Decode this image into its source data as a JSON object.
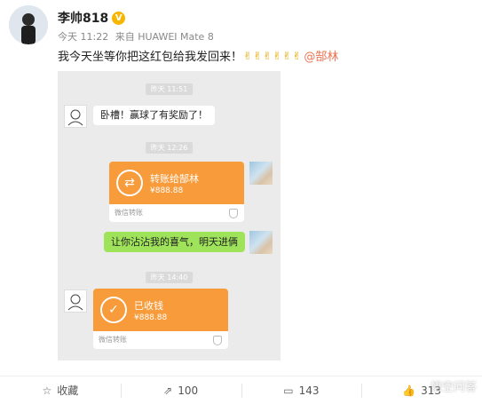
{
  "post": {
    "username": "李帅818",
    "verified_badge": "V",
    "time": "今天 11:22",
    "source": "来自 HUAWEI Mate 8",
    "text": "我今天坐等你把这红包给我发回来！",
    "emojis": [
      "✌",
      "✌",
      "✌",
      "✌",
      "✌",
      "✌"
    ],
    "mention": "@郜林"
  },
  "chat": {
    "timestamps": [
      "昨天 11:51",
      "昨天 12:26",
      "昨天 14:40"
    ],
    "message1": "卧槽！赢球了有奖励了！",
    "transfer1": {
      "title": "转账给郜林",
      "amount": "¥888.88",
      "footer": "微信转账"
    },
    "message2": "让你沾沾我的喜气，明天进俩",
    "transfer2": {
      "title": "已收钱",
      "amount": "¥888.88",
      "footer": "微信转账"
    }
  },
  "footer": {
    "favorite_label": "收藏",
    "repost_count": "100",
    "comment_count": "143",
    "like_count": "313"
  },
  "watermark": "悟空问答",
  "colors": {
    "accent": "#eb7350",
    "transfer_orange": "#f79b3b",
    "bubble_green": "#9fe35b",
    "badge": "#f7b600"
  }
}
